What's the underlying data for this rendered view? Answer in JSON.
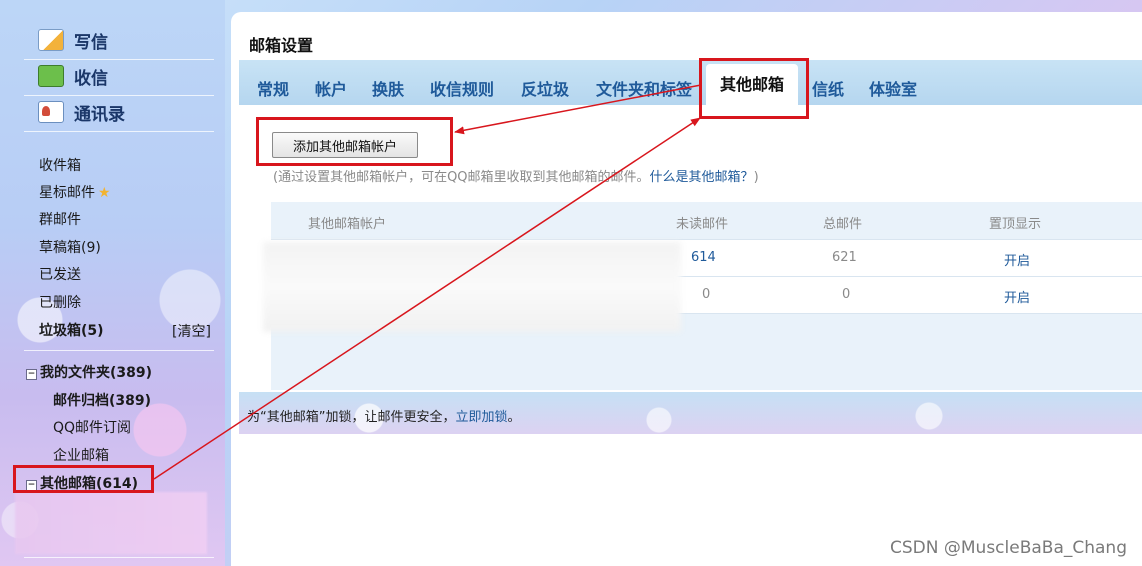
{
  "sidebar": {
    "top_links": [
      {
        "label": "写信",
        "icon": "write-pencil-icon"
      },
      {
        "label": "收信",
        "icon": "inbox-download-icon"
      },
      {
        "label": "通讯录",
        "icon": "address-book-icon"
      }
    ],
    "folders": [
      {
        "label": "收件箱"
      },
      {
        "label": "星标邮件",
        "icon": "star-icon"
      },
      {
        "label": "群邮件"
      },
      {
        "label": "草稿箱(9)"
      },
      {
        "label": "已发送"
      },
      {
        "label": "已删除"
      },
      {
        "label": "垃圾箱(5)"
      }
    ],
    "clear_label": "[清空]",
    "my_folders_label": "我的文件夹(389)",
    "my_folders_toggle": "−",
    "subfolders": [
      {
        "label": "邮件归档(389)"
      },
      {
        "label": "QQ邮件订阅"
      },
      {
        "label": "企业邮箱"
      }
    ],
    "other_mailbox_label": "其他邮箱(614)",
    "other_mailbox_toggle": "−"
  },
  "main": {
    "title": "邮箱设置",
    "tabs": [
      {
        "label": "常规"
      },
      {
        "label": "帐户"
      },
      {
        "label": "换肤"
      },
      {
        "label": "收信规则"
      },
      {
        "label": "反垃圾"
      },
      {
        "label": "文件夹和标签"
      },
      {
        "label": "其他邮箱",
        "active": true
      },
      {
        "label": "信纸"
      },
      {
        "label": "体验室"
      }
    ],
    "add_button_label": "添加其他邮箱帐户",
    "hint_text": "(通过设置其他邮箱帐户，可在QQ邮箱里收取到其他邮箱的邮件。",
    "hint_link": "什么是其他邮箱？",
    "hint_close": ")",
    "table": {
      "headers": [
        "其他邮箱帐户",
        "未读邮件",
        "总邮件",
        "置顶显示"
      ],
      "rows": [
        {
          "account": "",
          "unread": "614",
          "total": "621",
          "pin": "开启"
        },
        {
          "account": "",
          "unread": "0",
          "total": "0",
          "pin": "开启"
        }
      ]
    },
    "footer_text": "为“其他邮箱”加锁，让邮件更安全，",
    "footer_link": "立即加锁",
    "footer_end": "。"
  },
  "watermark": "CSDN @MuscleBaBa_Chang",
  "colors": {
    "annotation_red": "#d8161d",
    "link_blue": "#1f5a9a",
    "tab_bar": "#c8e3f5"
  }
}
